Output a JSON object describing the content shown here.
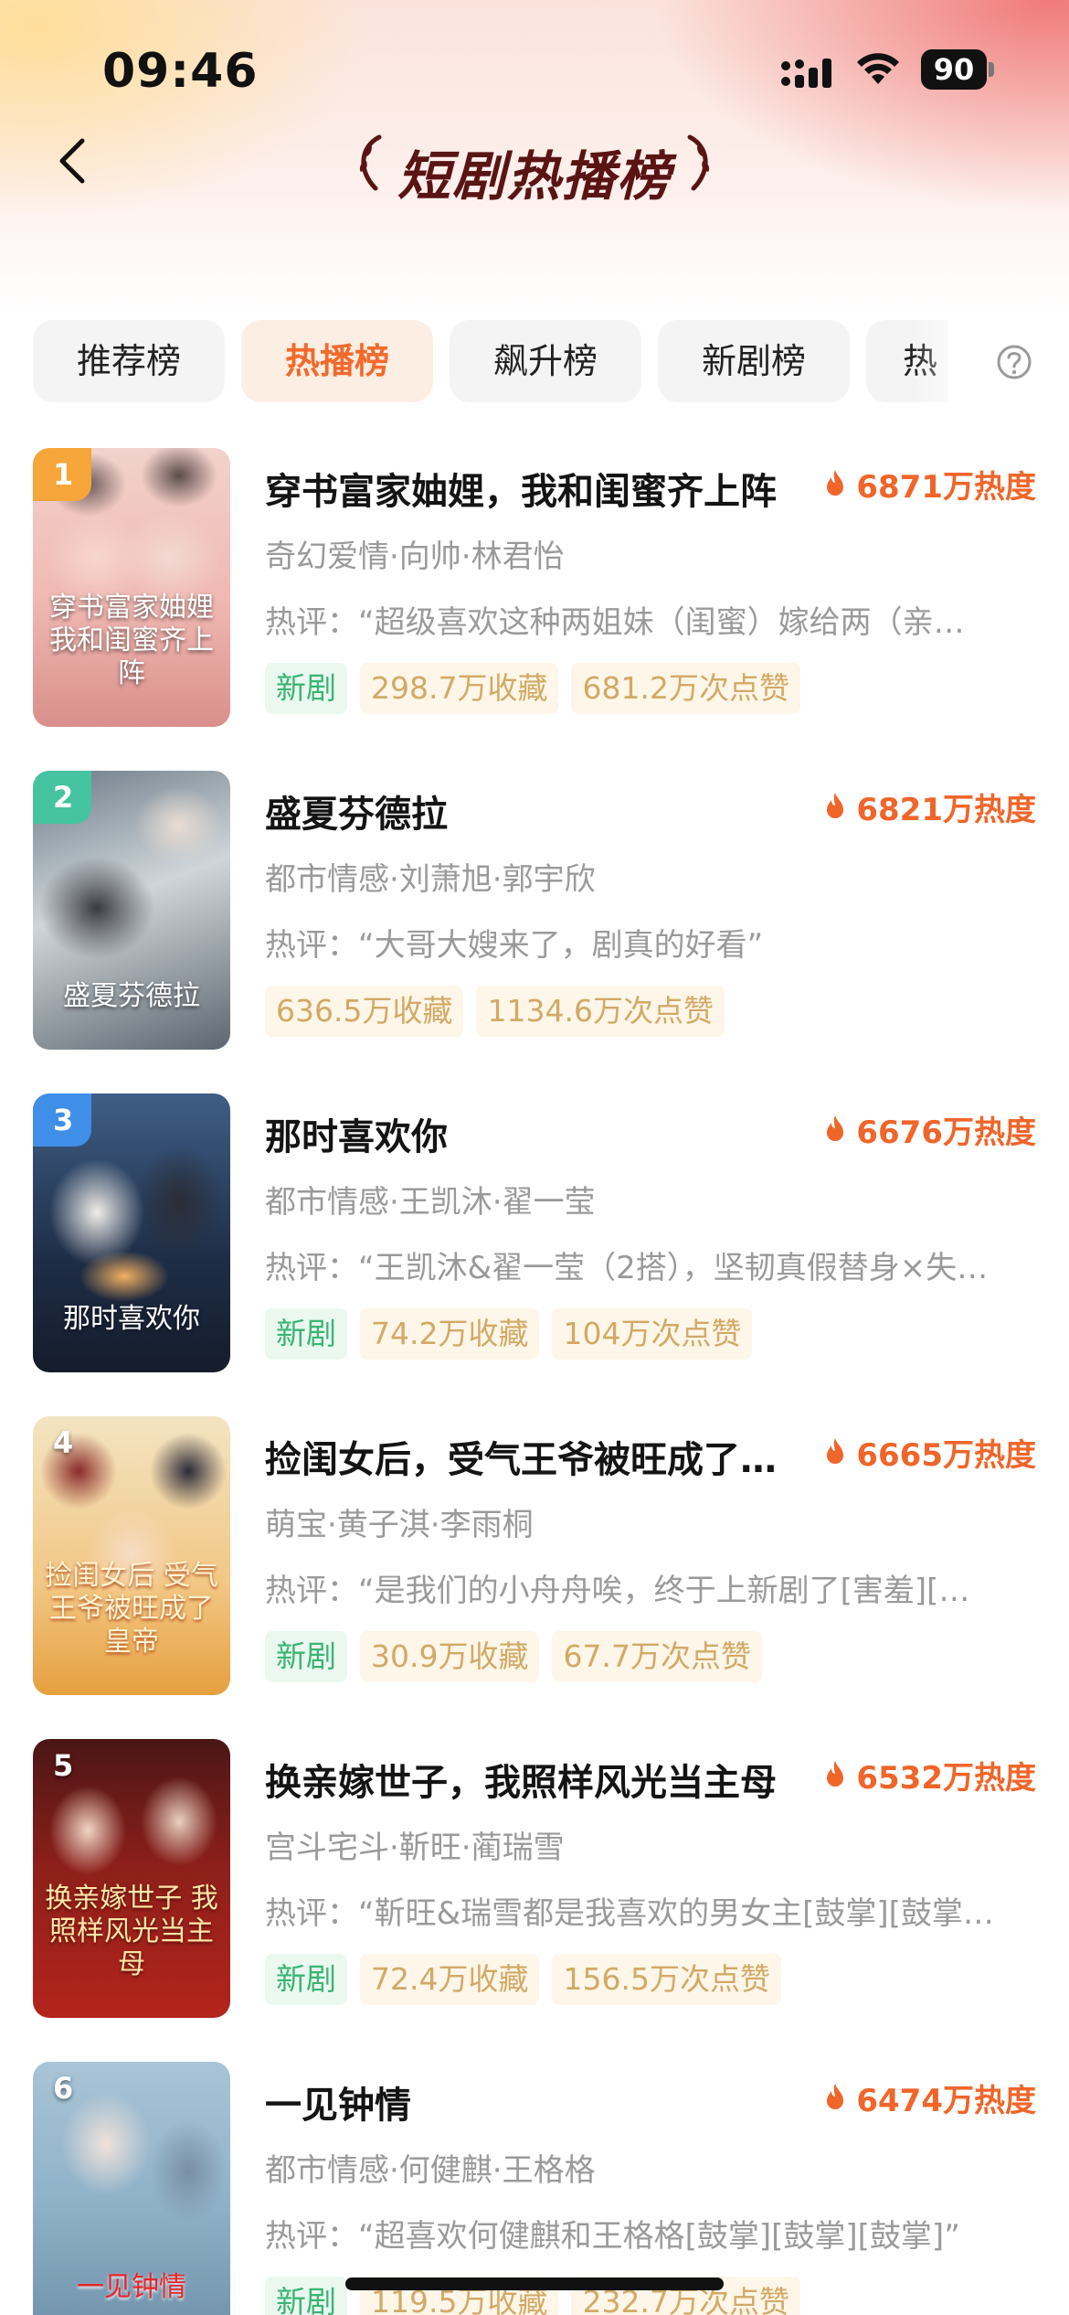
{
  "status_bar": {
    "time": "09:46",
    "battery": "90"
  },
  "nav": {
    "title": "短剧热播榜",
    "back_icon": "chevron-left-icon"
  },
  "tabs": [
    {
      "label": "推荐榜",
      "active": false
    },
    {
      "label": "热播榜",
      "active": true
    },
    {
      "label": "飙升榜",
      "active": false
    },
    {
      "label": "新剧榜",
      "active": false
    },
    {
      "label": "热",
      "active": false
    }
  ],
  "help_icon": "question-circle-icon",
  "colors": {
    "accent": "#f26a2b",
    "heat": "#f0652a",
    "new_tag": "#39b574",
    "stat_tag": "#d3a965",
    "title": "#5a1414"
  },
  "items": [
    {
      "rank": "1",
      "title": "穿书富家妯娌，我和闺蜜齐上阵",
      "heat": "6871万热度",
      "meta": "奇幻爱情·向帅·林君怡",
      "review": "热评：“超级喜欢这种两姐妹（闺蜜）嫁给两（亲…",
      "new_tag": "新剧",
      "favorites": "298.7万收藏",
      "likes": "681.2万次点赞",
      "poster_text": "穿书富家妯娌 我和闺蜜齐上阵"
    },
    {
      "rank": "2",
      "title": "盛夏芬德拉",
      "heat": "6821万热度",
      "meta": "都市情感·刘萧旭·郭宇欣",
      "review": "热评：“大哥大嫂来了，剧真的好看”",
      "new_tag": "",
      "favorites": "636.5万收藏",
      "likes": "1134.6万次点赞",
      "poster_text": "盛夏芬德拉"
    },
    {
      "rank": "3",
      "title": "那时喜欢你",
      "heat": "6676万热度",
      "meta": "都市情感·王凯沐·翟一莹",
      "review": "热评：“王凯沐&翟一莹（2搭），坚韧真假替身×失…",
      "new_tag": "新剧",
      "favorites": "74.2万收藏",
      "likes": "104万次点赞",
      "poster_text": "那时喜欢你"
    },
    {
      "rank": "4",
      "title": "捡闺女后，受气王爷被旺成了…",
      "heat": "6665万热度",
      "meta": "萌宝·黄子淇·李雨桐",
      "review": "热评：“是我们的小舟舟唉，终于上新剧了[害羞][…",
      "new_tag": "新剧",
      "favorites": "30.9万收藏",
      "likes": "67.7万次点赞",
      "poster_text": "捡闺女后 受气王爷被旺成了皇帝"
    },
    {
      "rank": "5",
      "title": "换亲嫁世子，我照样风光当主母",
      "heat": "6532万热度",
      "meta": "宫斗宅斗·靳旺·蔺瑞雪",
      "review": "热评：“靳旺&瑞雪都是我喜欢的男女主[鼓掌][鼓掌…",
      "new_tag": "新剧",
      "favorites": "72.4万收藏",
      "likes": "156.5万次点赞",
      "poster_text": "换亲嫁世子 我照样风光当主母"
    },
    {
      "rank": "6",
      "title": "一见钟情",
      "heat": "6474万热度",
      "meta": "都市情感·何健麒·王格格",
      "review": "热评：“超喜欢何健麒和王格格[鼓掌][鼓掌][鼓掌]”",
      "new_tag": "新剧",
      "favorites": "119.5万收藏",
      "likes": "232.7万次点赞",
      "poster_text": "一见钟情"
    }
  ]
}
